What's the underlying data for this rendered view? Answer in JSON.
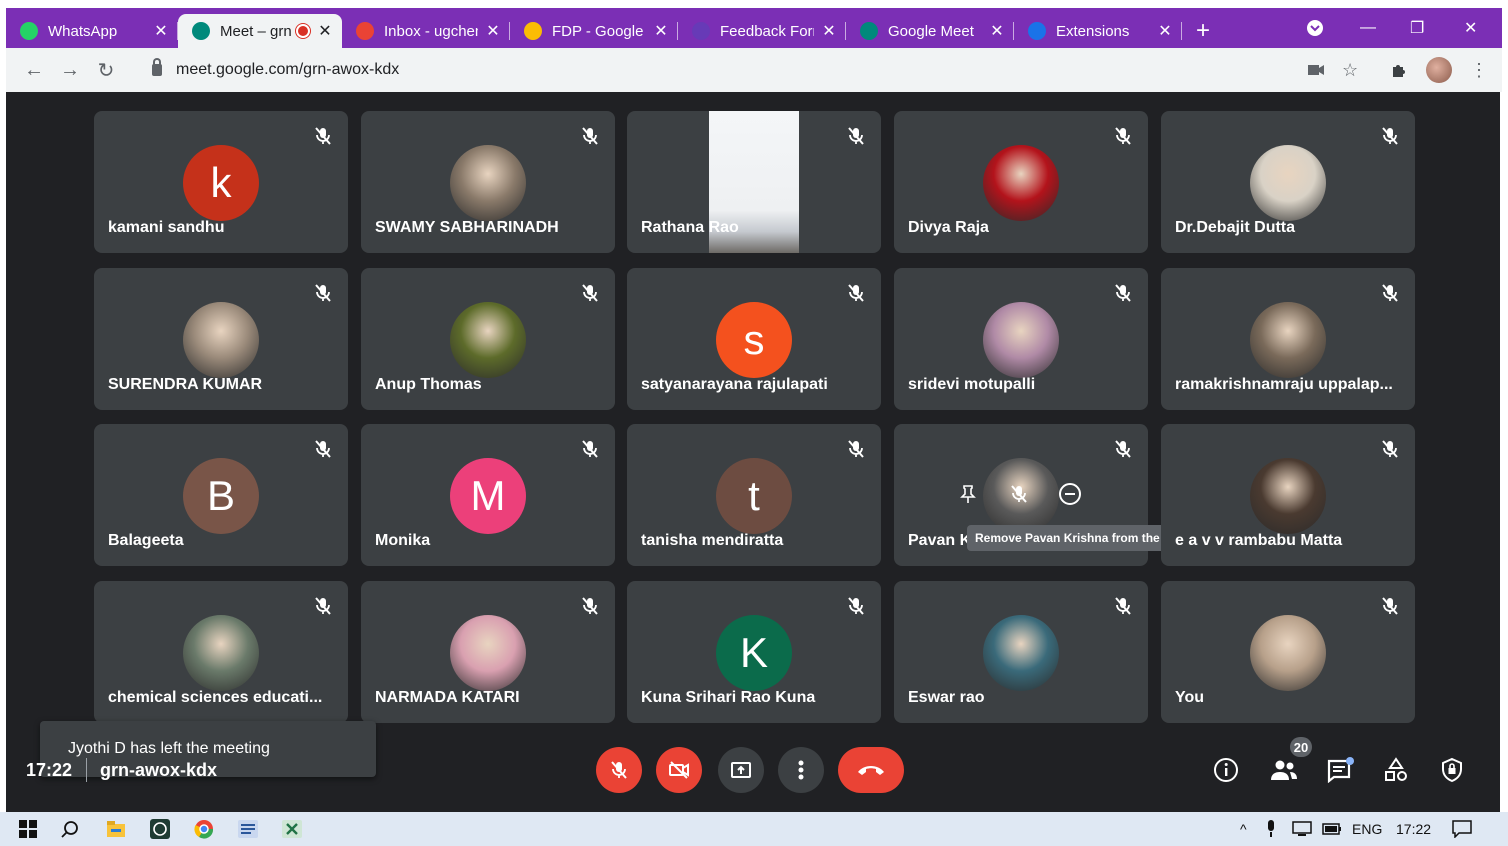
{
  "browser": {
    "tabs": [
      {
        "label": "WhatsApp",
        "icon": "whatsapp-icon",
        "color": "#25d366"
      },
      {
        "label": "Meet – grn",
        "icon": "meet-icon",
        "color": "#00897b",
        "active": true,
        "recording": true
      },
      {
        "label": "Inbox - ugchem",
        "icon": "gmail-icon",
        "color": "#ea4335"
      },
      {
        "label": "FDP - Google D",
        "icon": "drive-icon",
        "color": "#fbbc04"
      },
      {
        "label": "Feedback Form",
        "icon": "forms-icon",
        "color": "#673ab7"
      },
      {
        "label": "Google Meet",
        "icon": "meet-icon",
        "color": "#00897b"
      },
      {
        "label": "Extensions",
        "icon": "puzzle-icon",
        "color": "#1a73e8"
      }
    ],
    "url": "meet.google.com/grn-awox-kdx"
  },
  "participants": [
    {
      "name": "kamani sandhu",
      "type": "letter",
      "letter": "k",
      "color": "#c5311a"
    },
    {
      "name": "SWAMY SABHARINADH",
      "type": "photo",
      "color": "#8a7a6a"
    },
    {
      "name": "Rathana Rao",
      "type": "video"
    },
    {
      "name": "Divya Raja",
      "type": "photo",
      "color": "#b3131b"
    },
    {
      "name": "Dr.Debajit Dutta",
      "type": "photo",
      "color": "#d9d2c6"
    },
    {
      "name": "SURENDRA KUMAR",
      "type": "photo",
      "color": "#9a8a7a"
    },
    {
      "name": "Anup Thomas",
      "type": "photo",
      "color": "#5d6b2a"
    },
    {
      "name": "satyanarayana rajulapati",
      "type": "letter",
      "letter": "s",
      "color": "#f4511e"
    },
    {
      "name": "sridevi motupalli",
      "type": "photo",
      "color": "#b08aa6"
    },
    {
      "name": "ramakrishnamraju uppalap...",
      "type": "photo",
      "color": "#7a6a5a"
    },
    {
      "name": "Balageeta",
      "type": "letter",
      "letter": "B",
      "color": "#795548"
    },
    {
      "name": "Monika",
      "type": "letter",
      "letter": "M",
      "color": "#ec407a"
    },
    {
      "name": "tanisha mendiratta",
      "type": "letter",
      "letter": "t",
      "color": "#6d4c41"
    },
    {
      "name": "Pavan K",
      "type": "photo",
      "color": "#5a5a5a",
      "hovered": true
    },
    {
      "name": "e a v v rambabu Matta",
      "type": "photo",
      "color": "#4a3a30"
    },
    {
      "name": "chemical sciences educati...",
      "type": "photo",
      "color": "#6a7a6a"
    },
    {
      "name": "NARMADA KATARI",
      "type": "photo",
      "color": "#d9a0b0"
    },
    {
      "name": "Kuna Srihari Rao Kuna",
      "type": "letter",
      "letter": "K",
      "color": "#0b6b4b"
    },
    {
      "name": "Eswar rao",
      "type": "photo",
      "color": "#3a6a7a"
    },
    {
      "name": "You",
      "type": "photo",
      "color": "#b7a08a"
    }
  ],
  "hover_tooltip": "Remove Pavan Krishna from the call",
  "toast": "Jyothi D has left the meeting",
  "meeting": {
    "time": "17:22",
    "code": "grn-awox-kdx",
    "participant_count": "20"
  },
  "taskbar": {
    "language": "ENG",
    "time": "17:22"
  }
}
